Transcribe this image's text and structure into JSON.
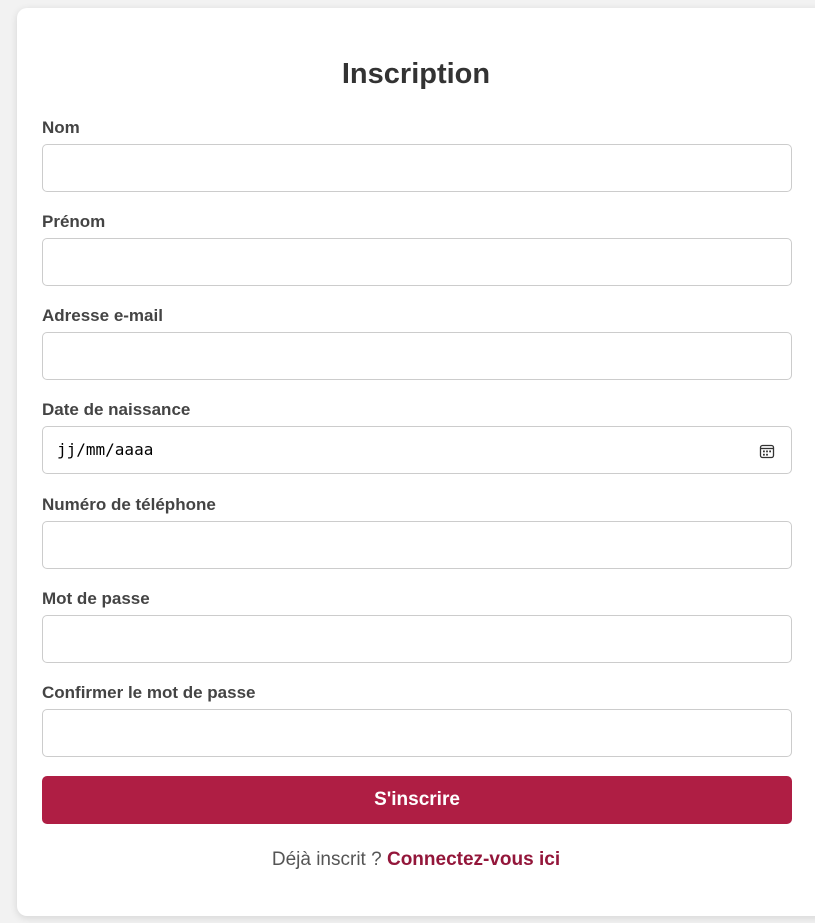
{
  "form": {
    "title": "Inscription",
    "fields": [
      {
        "label": "Nom",
        "value": ""
      },
      {
        "label": "Prénom",
        "value": ""
      },
      {
        "label": "Adresse e-mail",
        "value": ""
      },
      {
        "label": "Date de naissance",
        "value": "jj/mm/aaaa"
      },
      {
        "label": "Numéro de téléphone",
        "value": ""
      },
      {
        "label": "Mot de passe",
        "value": ""
      },
      {
        "label": "Confirmer le mot de passe",
        "value": ""
      }
    ],
    "submit_label": "S'inscrire",
    "footer": {
      "text": "Déjà inscrit ?",
      "link_label": "Connectez-vous ici"
    }
  },
  "colors": {
    "accent": "#af1e44",
    "link": "#93163a",
    "page_background": "#f2f2f2"
  },
  "icons": {
    "date_picker": "calendar-icon"
  }
}
